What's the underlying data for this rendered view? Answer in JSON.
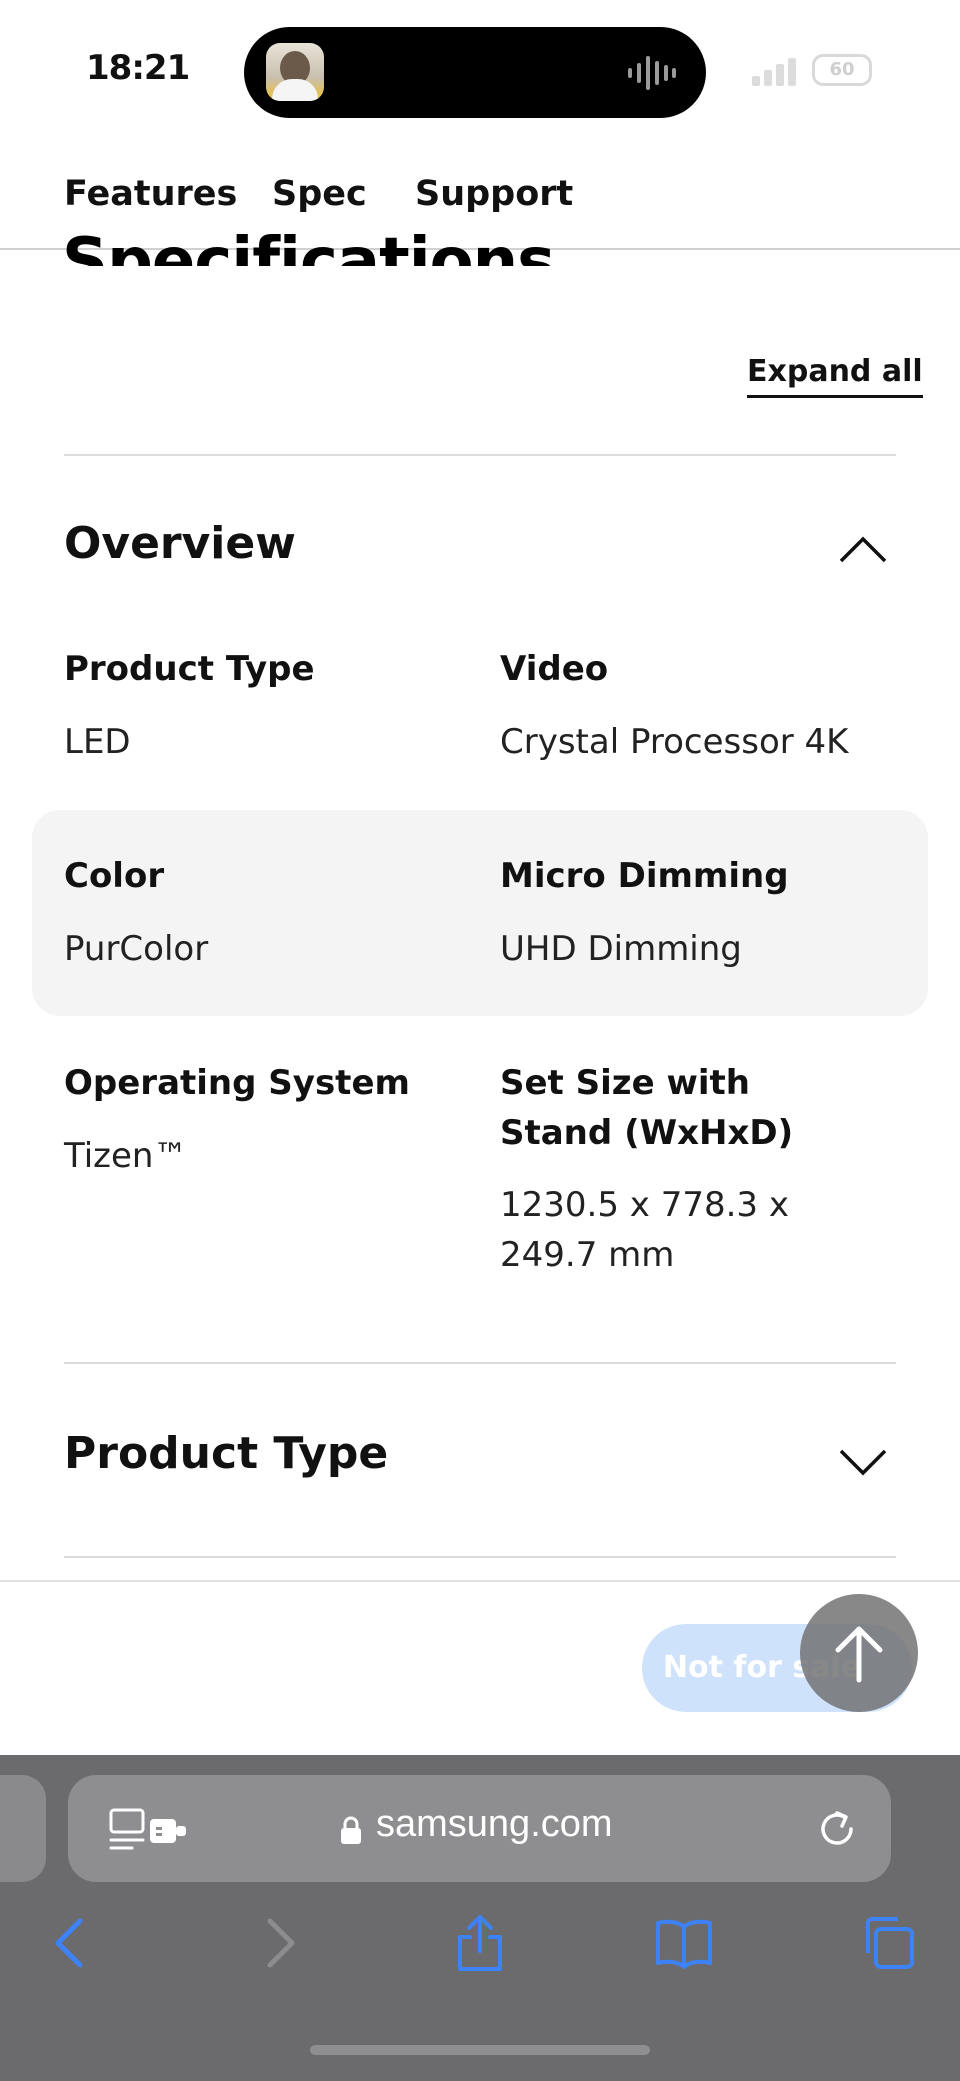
{
  "status_bar": {
    "time": "18:21",
    "battery": "60"
  },
  "subnav": {
    "tabs": [
      "Features",
      "Spec",
      "Support"
    ]
  },
  "specifications": {
    "heading": "Specifications",
    "expand_all": "Expand all",
    "sections": [
      {
        "title": "Overview",
        "expanded": true,
        "items": [
          {
            "label": "Product Type",
            "value": "LED"
          },
          {
            "label": "Video",
            "value": "Crystal Processor 4K"
          },
          {
            "label": "Color",
            "value": "PurColor"
          },
          {
            "label": "Micro Dimming",
            "value": "UHD Dimming"
          },
          {
            "label": "Operating System",
            "value": "Tizen™"
          },
          {
            "label": "Set Size with Stand (WxHxD)",
            "value": "1230.5 x 778.3 x 249.7 mm"
          }
        ]
      },
      {
        "title": "Product Type",
        "expanded": false
      }
    ]
  },
  "purchase": {
    "button_label": "Not for sale"
  },
  "browser": {
    "url": "samsung.com"
  },
  "colors": {
    "button_disabled_bg": "#cfe2fb",
    "safari_icon_blue": "#3d83f7",
    "safari_toolbar_bg": "#6b6b6d"
  },
  "icons": {
    "chevron_up": "chevron-up-icon",
    "chevron_down": "chevron-down-icon",
    "scroll_top": "arrow-up-icon",
    "back": "back-arrow-icon",
    "forward": "forward-arrow-icon",
    "share": "share-icon",
    "bookmarks": "bookmarks-icon",
    "tabs": "tabs-icon",
    "reload": "reload-icon",
    "lock": "lock-icon",
    "reader": "reader-mode-icon"
  }
}
